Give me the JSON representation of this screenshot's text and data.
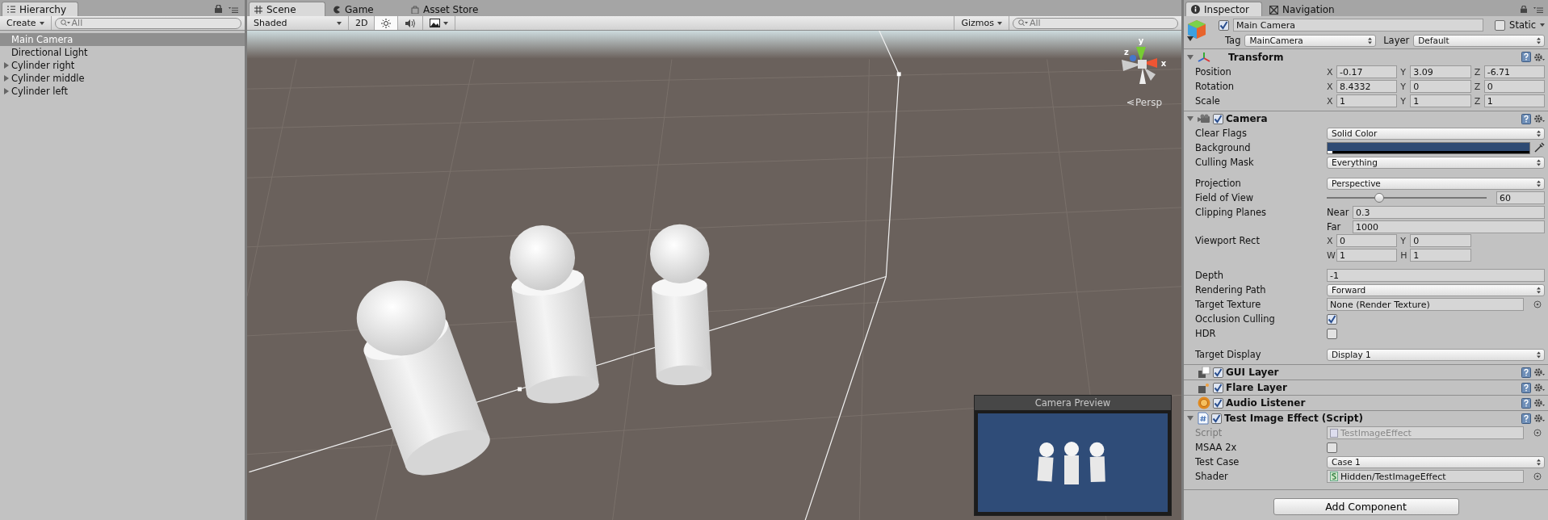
{
  "hierarchy": {
    "tab": "Hierarchy",
    "create": "Create",
    "search": {
      "placeholder": "All"
    },
    "items": [
      {
        "label": "Main Camera",
        "selected": true,
        "has_children": false
      },
      {
        "label": "Directional Light",
        "selected": false,
        "has_children": false
      },
      {
        "label": "Cylinder right",
        "selected": false,
        "has_children": true
      },
      {
        "label": "Cylinder middle",
        "selected": false,
        "has_children": true
      },
      {
        "label": "Cylinder left",
        "selected": false,
        "has_children": true
      }
    ]
  },
  "scene": {
    "tabs": [
      {
        "label": "Scene",
        "kind": "grid",
        "selected": true
      },
      {
        "label": "Game",
        "kind": "pacman",
        "selected": false
      },
      {
        "label": "Asset Store",
        "kind": "bag",
        "selected": false
      }
    ],
    "toolbar": {
      "shading": "Shaded",
      "mode_2d": "2D",
      "toggles": [
        {
          "kind": "sun",
          "on": true
        },
        {
          "kind": "speaker",
          "on": false
        },
        {
          "kind": "image",
          "on": false
        }
      ],
      "gizmos": "Gizmos",
      "search": {
        "placeholder": "All"
      }
    },
    "gizmo": {
      "x": "x",
      "y": "y",
      "z": "z",
      "projection": "Persp"
    },
    "camera_preview": {
      "title": "Camera Preview",
      "color": "#2f4c78"
    }
  },
  "inspector": {
    "tabs": [
      {
        "label": "Inspector",
        "kind": "info",
        "selected": true
      },
      {
        "label": "Navigation",
        "kind": "nav",
        "selected": false
      }
    ],
    "object": {
      "active": true,
      "name": "Main Camera",
      "static_label": "Static",
      "static": false,
      "tag_label": "Tag",
      "tag": "MainCamera",
      "layer_label": "Layer",
      "layer": "Default"
    },
    "components": [
      {
        "name": "Transform",
        "kind": "transform",
        "expanded": true,
        "rows": [
          {
            "kind": "vector",
            "label": "Position",
            "lines": [
              [
                {
                  "axis": "X",
                  "value": "-0.17"
                },
                {
                  "axis": "Y",
                  "value": "3.09"
                },
                {
                  "axis": "Z",
                  "value": "-6.71"
                }
              ]
            ]
          },
          {
            "kind": "vector",
            "label": "Rotation",
            "lines": [
              [
                {
                  "axis": "X",
                  "value": "8.4332"
                },
                {
                  "axis": "Y",
                  "value": "0"
                },
                {
                  "axis": "Z",
                  "value": "0"
                }
              ]
            ]
          },
          {
            "kind": "vector",
            "label": "Scale",
            "lines": [
              [
                {
                  "axis": "X",
                  "value": "1"
                },
                {
                  "axis": "Y",
                  "value": "1"
                },
                {
                  "axis": "Z",
                  "value": "1"
                }
              ]
            ]
          }
        ]
      },
      {
        "name": "Camera",
        "kind": "camera",
        "enabled": true,
        "expanded": true,
        "rows": [
          {
            "kind": "dropdown",
            "label": "Clear Flags",
            "value": "Solid Color"
          },
          {
            "kind": "color",
            "label": "Background",
            "color": "#2e4a73"
          },
          {
            "kind": "dropdown",
            "label": "Culling Mask",
            "value": "Everything"
          },
          {
            "kind": "dropdown",
            "label": "Projection",
            "value": "Perspective",
            "gap_before": true
          },
          {
            "kind": "slider",
            "label": "Field of View",
            "level": 0.33,
            "value": "60"
          },
          {
            "kind": "pair",
            "label": "Clipping Planes",
            "lines": [
              {
                "label": "Near",
                "value": "0.3"
              },
              {
                "label": "Far",
                "value": "1000"
              }
            ]
          },
          {
            "kind": "vector",
            "label": "Viewport Rect",
            "lines": [
              [
                {
                  "axis": "X",
                  "value": "0"
                },
                {
                  "axis": "Y",
                  "value": "0"
                }
              ],
              [
                {
                  "axis": "W",
                  "value": "1"
                },
                {
                  "axis": "H",
                  "value": "1"
                }
              ]
            ]
          },
          {
            "kind": "text",
            "label": "Depth",
            "value": "-1",
            "gap_before": true
          },
          {
            "kind": "dropdown",
            "label": "Rendering Path",
            "value": "Forward"
          },
          {
            "kind": "object",
            "label": "Target Texture",
            "value": "None (Render Texture)",
            "disabled": false
          },
          {
            "kind": "checkbox",
            "label": "Occlusion Culling",
            "checked": true
          },
          {
            "kind": "checkbox",
            "label": "HDR",
            "checked": false
          },
          {
            "kind": "dropdown",
            "label": "Target Display",
            "value": "Display 1",
            "gap_before": true
          }
        ]
      },
      {
        "name": "GUI Layer",
        "kind": "gui",
        "enabled": true
      },
      {
        "name": "Flare Layer",
        "kind": "flare",
        "enabled": true
      },
      {
        "name": "Audio Listener",
        "kind": "audio",
        "enabled": true
      },
      {
        "name": "Test Image Effect (Script)",
        "kind": "script",
        "enabled": true,
        "expanded": true,
        "rows": [
          {
            "kind": "script",
            "label": "Script",
            "value": "TestImageEffect",
            "disabled": true
          },
          {
            "kind": "checkbox",
            "label": "MSAA 2x",
            "checked": false
          },
          {
            "kind": "dropdown",
            "label": "Test Case",
            "value": "Case 1"
          },
          {
            "kind": "shader",
            "label": "Shader",
            "value": "Hidden/TestImageEffect",
            "disabled": false
          }
        ]
      }
    ],
    "add_component": "Add Component"
  }
}
